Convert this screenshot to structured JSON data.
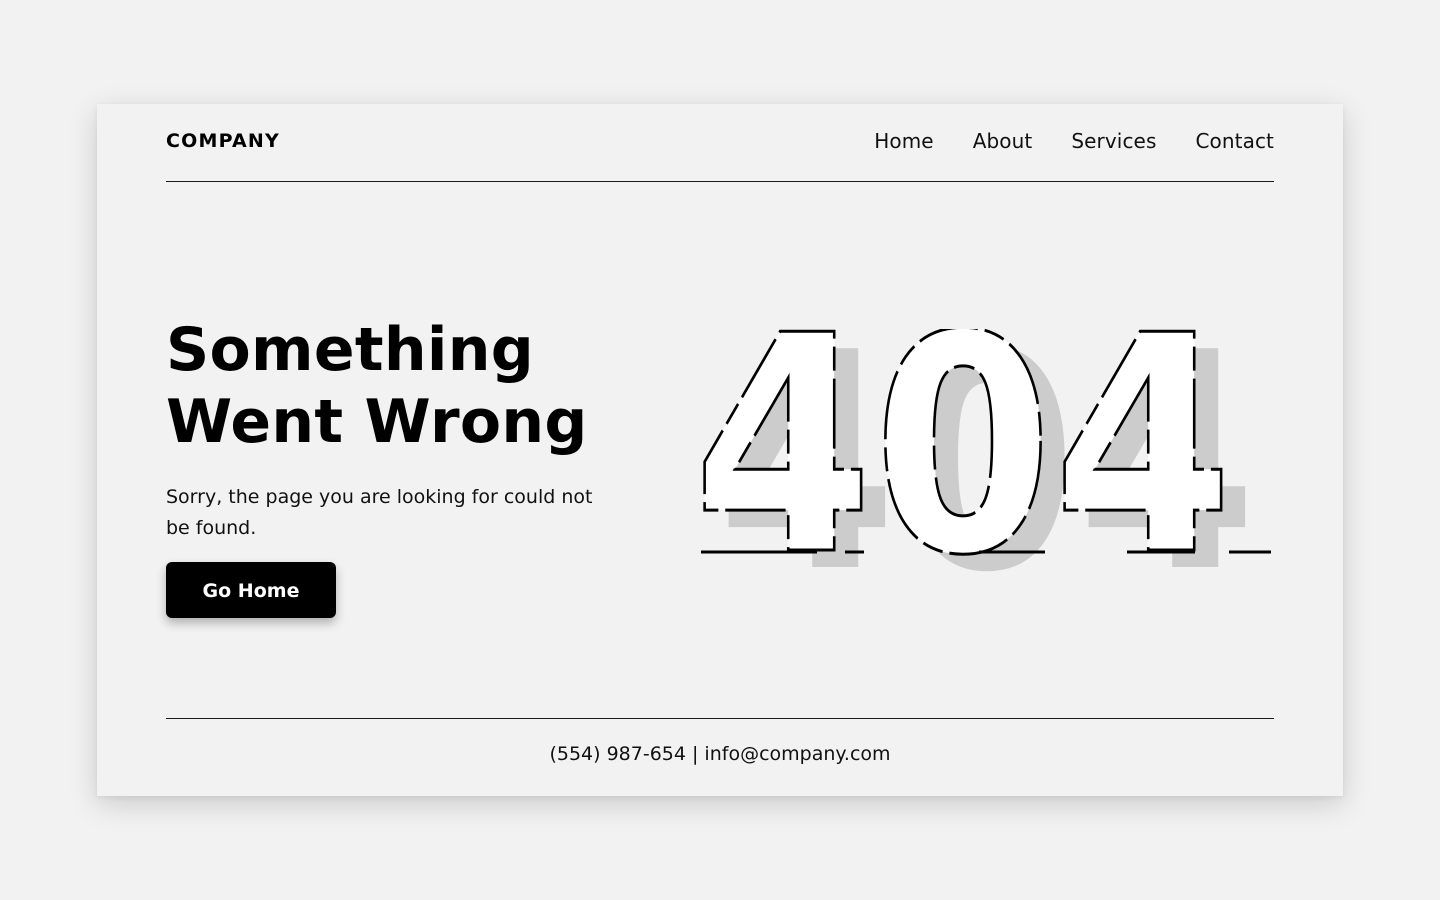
{
  "header": {
    "logo": "COMPANY",
    "nav": [
      "Home",
      "About",
      "Services",
      "Contact"
    ]
  },
  "hero": {
    "title_line1": "Something",
    "title_line2": "Went Wrong",
    "subtitle": "Sorry, the page you are looking for could not be found.",
    "button_label": "Go Home",
    "error_code": "404"
  },
  "footer": {
    "contact": "(554) 987-654 | info@company.com"
  },
  "colors": {
    "background": "#f2f2f2",
    "text": "#000000",
    "button_bg": "#000000",
    "button_text": "#ffffff",
    "code_fill": "#ffffff",
    "code_shadow": "#cccccc"
  }
}
